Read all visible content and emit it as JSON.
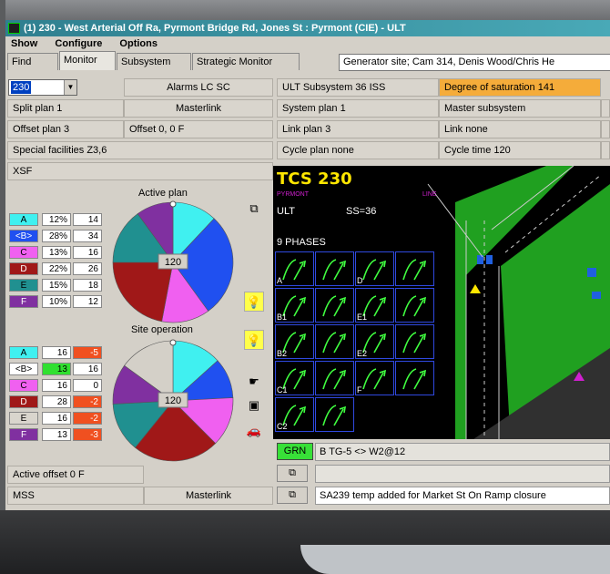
{
  "window": {
    "title": "(1)  230 - West Arterial Off Ra, Pyrmont Bridge Rd, Jones St : Pyrmont (CIE) - ULT"
  },
  "menu": [
    "Show",
    "Configure",
    "Options"
  ],
  "tabs": [
    "Find",
    "Monitor",
    "Subsystem",
    "Strategic Monitor"
  ],
  "active_tab": "Monitor",
  "info_text": "Generator site; Cam 314, Denis Wood/Chris He",
  "site_select": "230",
  "left_fields": {
    "alarms": "Alarms LC SC",
    "split_plan": "Split plan 1",
    "masterlink": "Masterlink",
    "offset_plan": "Offset plan 3",
    "offset_value": "Offset 0, 0 F",
    "special": "Special facilities  Z3,6",
    "xsf": "XSF"
  },
  "right_fields": {
    "subsystem": "ULT Subsystem 36 ISS",
    "saturation": "Degree of saturation 141",
    "system_plan": "System plan 1",
    "master_subsystem": "Master subsystem",
    "link_plan": "Link plan 3",
    "link": "Link none",
    "cycle_plan": "Cycle plan none",
    "cycle_time": "Cycle time 120"
  },
  "active_plan": {
    "label": "Active plan",
    "center": "120",
    "rows": [
      {
        "phase": "A",
        "pct": "12%",
        "secs": "14",
        "color": "#40f0f0"
      },
      {
        "phase": "<B>",
        "pct": "28%",
        "secs": "34",
        "color": "#2050f0"
      },
      {
        "phase": "C",
        "pct": "13%",
        "secs": "16",
        "color": "#f060f0"
      },
      {
        "phase": "D",
        "pct": "22%",
        "secs": "26",
        "color": "#a01818"
      },
      {
        "phase": "E",
        "pct": "15%",
        "secs": "18",
        "color": "#209090"
      },
      {
        "phase": "F",
        "pct": "10%",
        "secs": "12",
        "color": "#8030a0"
      }
    ]
  },
  "site_operation": {
    "label": "Site operation",
    "center": "120",
    "rows": [
      {
        "phase": "A",
        "v1": "16",
        "v2": "-5",
        "lcolor": "#40f0f0",
        "v1color": "#ffffff",
        "v2color": "#f05020"
      },
      {
        "phase": "<B>",
        "v1": "13",
        "v2": "16",
        "lcolor": "#ffffff",
        "v1color": "#30e030",
        "v2color": "#ffffff"
      },
      {
        "phase": "C",
        "v1": "16",
        "v2": "0",
        "lcolor": "#f060f0",
        "v1color": "#ffffff",
        "v2color": "#ffffff"
      },
      {
        "phase": "D",
        "v1": "28",
        "v2": "-2",
        "lcolor": "#a01818",
        "v1color": "#ffffff",
        "v2color": "#f05020"
      },
      {
        "phase": "E",
        "v1": "16",
        "v2": "-2",
        "lcolor": "#d9d5cd",
        "v1color": "#ffffff",
        "v2color": "#f05020"
      },
      {
        "phase": "F",
        "v1": "13",
        "v2": "-3",
        "lcolor": "#8030a0",
        "v1color": "#ffffff",
        "v2color": "#f05020"
      }
    ]
  },
  "bottom_left": {
    "active_offset": "Active offset 0 F",
    "mss": "MSS",
    "masterlink": "Masterlink"
  },
  "tcs": {
    "title": "TCS 230",
    "ult": "ULT",
    "ss": "SS=36",
    "phases_label": "9 PHASES",
    "pyrmont": "PYRMONT",
    "line": "LINE",
    "phase_labels": [
      "A",
      "D",
      "B1",
      "E1",
      "B2",
      "E2",
      "C1",
      "F",
      "C2"
    ]
  },
  "status": {
    "grn": "GRN",
    "stage_text": "B TG-5 <> W2@12",
    "message": "SA239 temp added for Market St On Ramp closure"
  }
}
